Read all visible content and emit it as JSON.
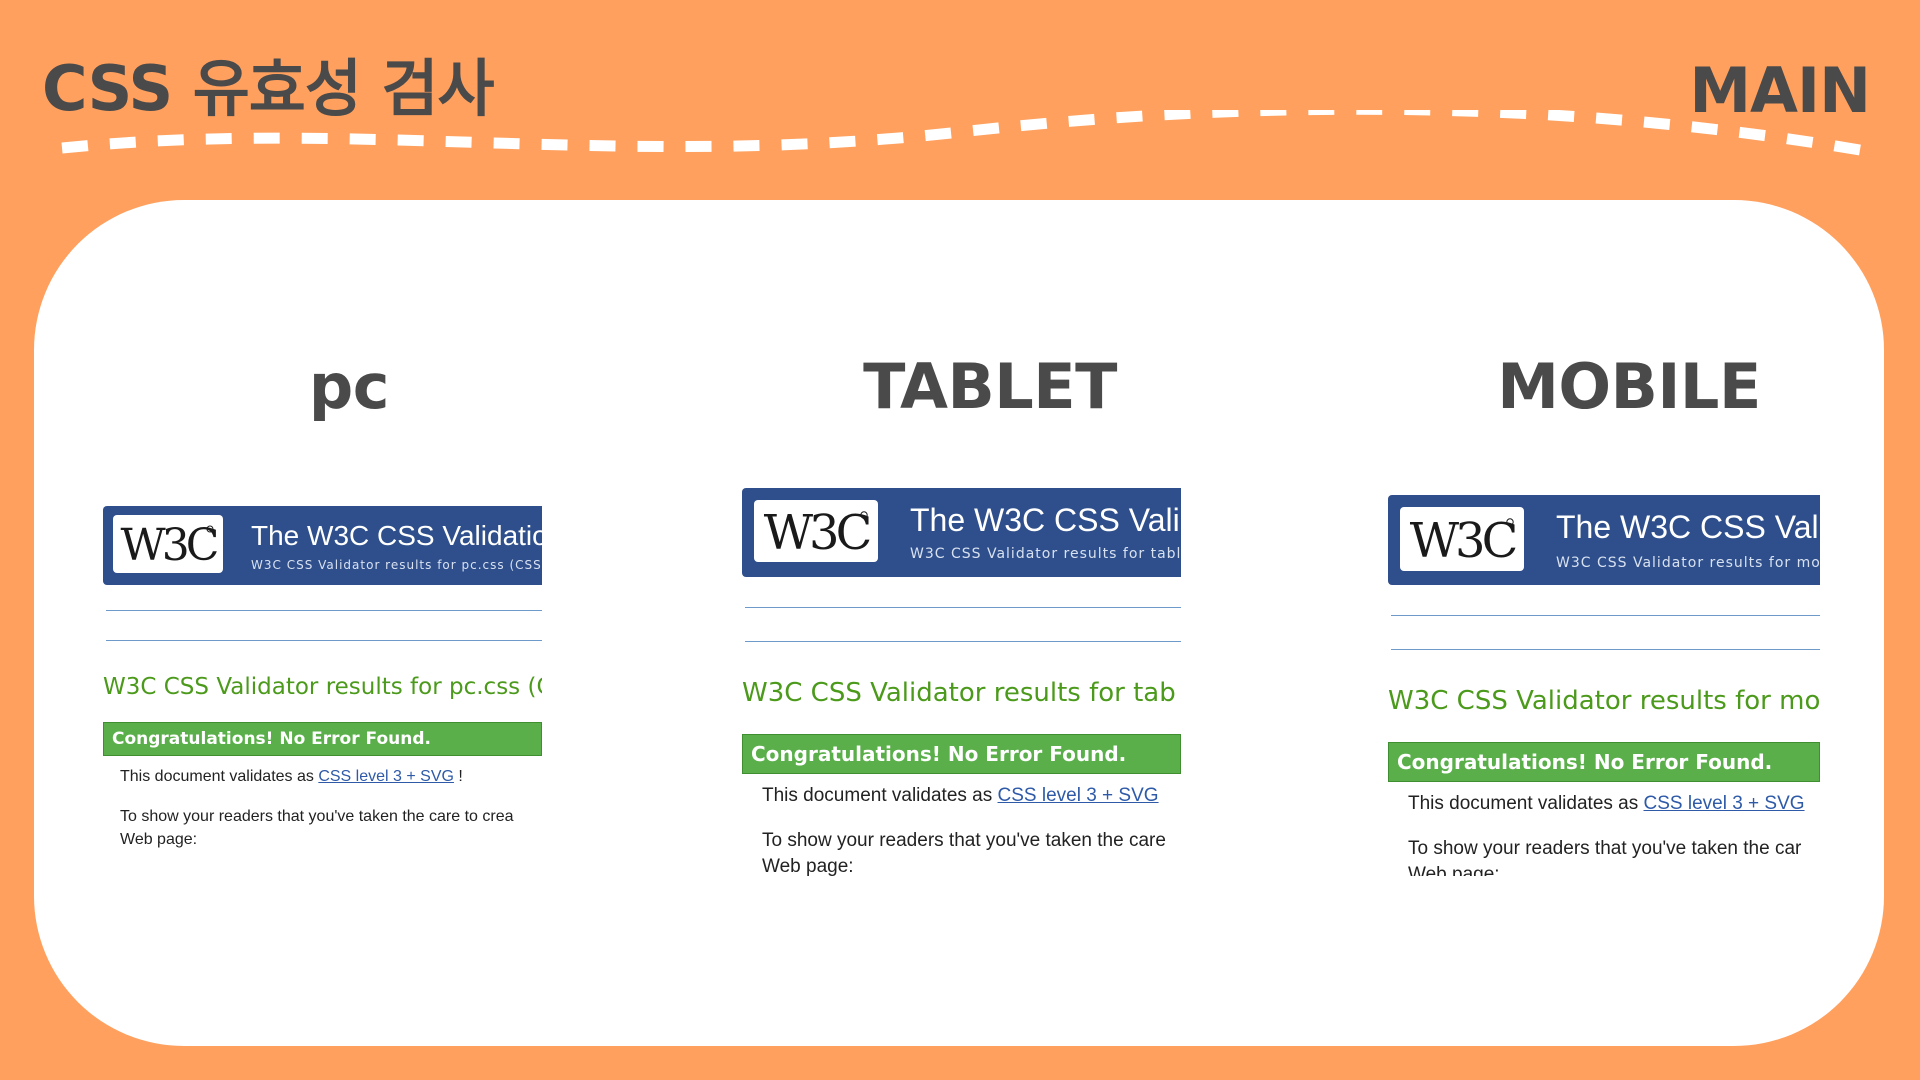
{
  "header": {
    "title": "CSS 유효성 검사",
    "tag": "MAIN"
  },
  "colors": {
    "background": "#FFA05E",
    "panel": "#FFFFFF",
    "heading_text": "#4A4A4A",
    "w3c_banner": "#2E4F8C",
    "result_green": "#4C9A1C",
    "congrats_bar": "#5AAF4A",
    "link": "#2E5AA8"
  },
  "columns": [
    {
      "label": "pc",
      "banner_title": "The W3C CSS Validatio",
      "banner_subtitle": "W3C CSS Validator results for pc.css (CSS l",
      "result_heading": "W3C CSS Validator results for pc.css (C",
      "congrats": "Congratulations! No Error Found.",
      "validates_prefix": "This document validates as ",
      "validates_link": "CSS level 3 + SVG",
      "validates_suffix": " !",
      "show_line1": "To show your readers that you've taken the care to crea",
      "show_line2": "Web page:"
    },
    {
      "label": "TABLET",
      "banner_title": "The W3C CSS Vali",
      "banner_subtitle": "W3C CSS Validator results for table",
      "result_heading": "W3C CSS Validator results for tab",
      "congrats": "Congratulations! No Error Found.",
      "validates_prefix": "This document validates as ",
      "validates_link": "CSS level 3 + SVG",
      "validates_suffix": "",
      "show_line1": "To show your readers that you've taken the care",
      "show_line2": "Web page:"
    },
    {
      "label": "MOBILE",
      "banner_title": "The W3C CSS Val",
      "banner_subtitle": "W3C CSS Validator results for mob",
      "result_heading": "W3C CSS Validator results for mo",
      "congrats": "Congratulations! No Error Found.",
      "validates_prefix": "This document validates as ",
      "validates_link": "CSS level 3 + SVG",
      "validates_suffix": "",
      "show_line1": "To show your readers that you've taken the car",
      "show_line2": "Web page:"
    }
  ]
}
